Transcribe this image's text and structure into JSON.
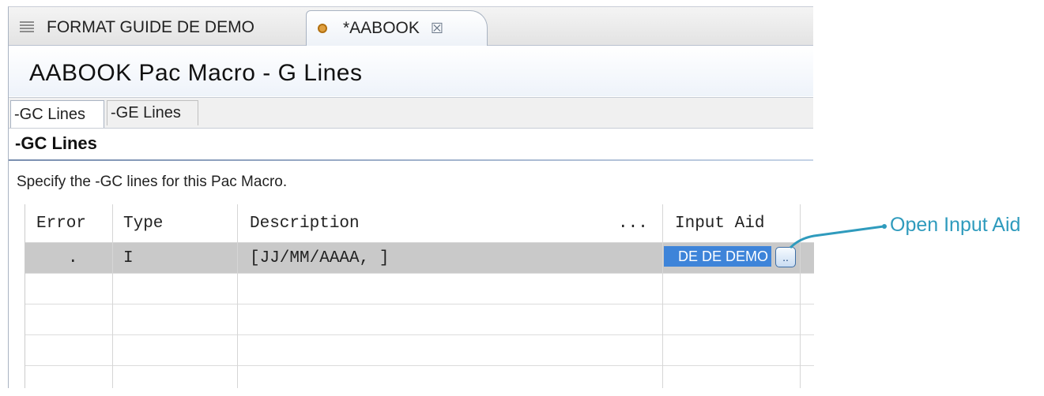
{
  "editor_tabs": [
    {
      "label": "FORMAT GUIDE DE DEMO",
      "icon": "document-icon"
    },
    {
      "label": "*AABOOK",
      "icon": "gear-icon",
      "close_glyph": "☒"
    }
  ],
  "page_title": "AABOOK Pac Macro - G Lines",
  "sub_tabs": [
    {
      "label": "-GC Lines",
      "selected": true
    },
    {
      "label": "-GE Lines",
      "selected": false
    }
  ],
  "section": {
    "title": "-GC Lines",
    "description": "Specify the -GC lines for this Pac Macro."
  },
  "grid": {
    "columns": [
      "Error",
      "Type",
      "Description",
      "...",
      "Input Aid"
    ],
    "rows": [
      {
        "error": ".",
        "type": "I",
        "description": "[JJ/MM/AAAA, ]",
        "input_aid": "DE DE DEMO",
        "selected": true
      }
    ],
    "ellipsis_button_label": ".."
  },
  "callout": {
    "label": "Open Input Aid",
    "color": "#2f9bbd"
  },
  "colors": {
    "selection": "#3e84d9",
    "row_highlight": "#c9c9c9"
  }
}
